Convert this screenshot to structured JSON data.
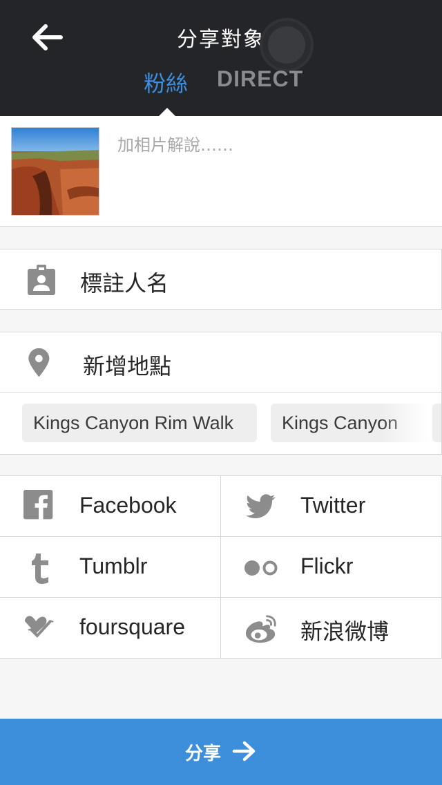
{
  "header": {
    "title": "分享對象",
    "back_icon": "arrow-left-icon",
    "tabs": [
      {
        "label": "粉絲",
        "active": true
      },
      {
        "label": "DIRECT",
        "active": false
      }
    ],
    "active_color": "#3d8fe0",
    "background": "#242529"
  },
  "caption": {
    "placeholder": "加相片解說……",
    "value": ""
  },
  "tag_people": {
    "label": "標註人名",
    "icon": "person-badge-icon"
  },
  "location": {
    "label": "新增地點",
    "icon": "map-pin-icon",
    "suggestions": [
      "Kings Canyon Rim Walk",
      "Kings Canyon"
    ]
  },
  "share_targets": [
    {
      "label": "Facebook",
      "icon": "facebook-icon"
    },
    {
      "label": "Twitter",
      "icon": "twitter-icon"
    },
    {
      "label": "Tumblr",
      "icon": "tumblr-icon"
    },
    {
      "label": "Flickr",
      "icon": "flickr-icon"
    },
    {
      "label": "foursquare",
      "icon": "foursquare-icon"
    },
    {
      "label": "新浪微博",
      "icon": "weibo-icon"
    }
  ],
  "share_button": {
    "label": "分享",
    "icon": "arrow-right-icon",
    "color": "#3d8fdc"
  }
}
